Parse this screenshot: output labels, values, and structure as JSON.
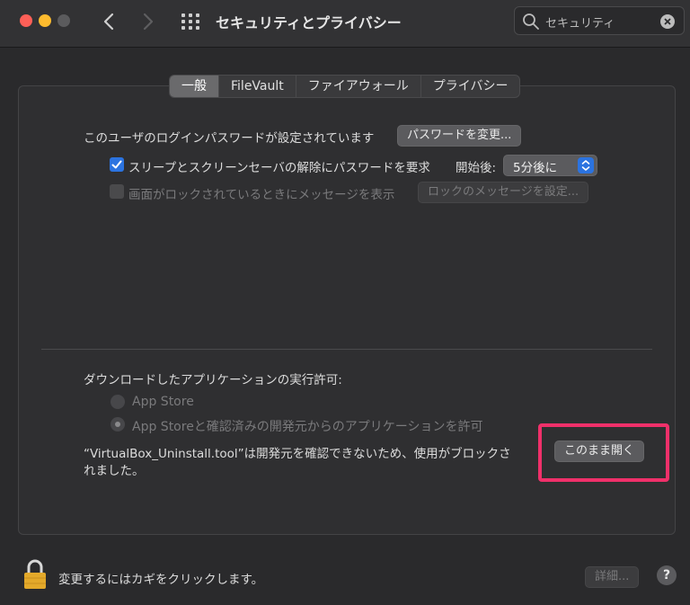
{
  "window": {
    "title": "セキュリティとプライバシー",
    "search_value": "セキュリティ"
  },
  "tabs": [
    {
      "label": "一般",
      "active": true
    },
    {
      "label": "FileVault",
      "active": false
    },
    {
      "label": "ファイアウォール",
      "active": false
    },
    {
      "label": "プライバシー",
      "active": false
    }
  ],
  "general": {
    "password_set_text": "このユーザのログインパスワードが設定されています",
    "change_password_button": "パスワードを変更...",
    "require_password_label": "スリープとスクリーンセーバの解除にパスワードを要求",
    "require_password_checked": true,
    "start_after_label": "開始後:",
    "start_after_value": "5分後に",
    "show_message_label": "画面がロックされているときにメッセージを表示",
    "show_message_checked": false,
    "set_lock_message_button": "ロックのメッセージを設定..."
  },
  "downloads": {
    "heading": "ダウンロードしたアプリケーションの実行許可:",
    "option_app_store": "App Store",
    "option_app_store_identified": "App Storeと確認済みの開発元からのアプリケーションを許可",
    "selected_option": "option_app_store_identified",
    "blocked_message_line1": "“VirtualBox_Uninstall.tool”は開発元を確認できないため、使用がブロックさ",
    "blocked_message_line2": "れました。",
    "open_anyway_button": "このまま開く"
  },
  "footer": {
    "lock_text": "変更するにはカギをクリックします。",
    "advanced_button": "詳細...",
    "help_label": "?"
  },
  "colors": {
    "accent": "#2b73e0",
    "highlight": "#f0306a",
    "close": "#fe5f57",
    "minimize": "#febb2e"
  }
}
